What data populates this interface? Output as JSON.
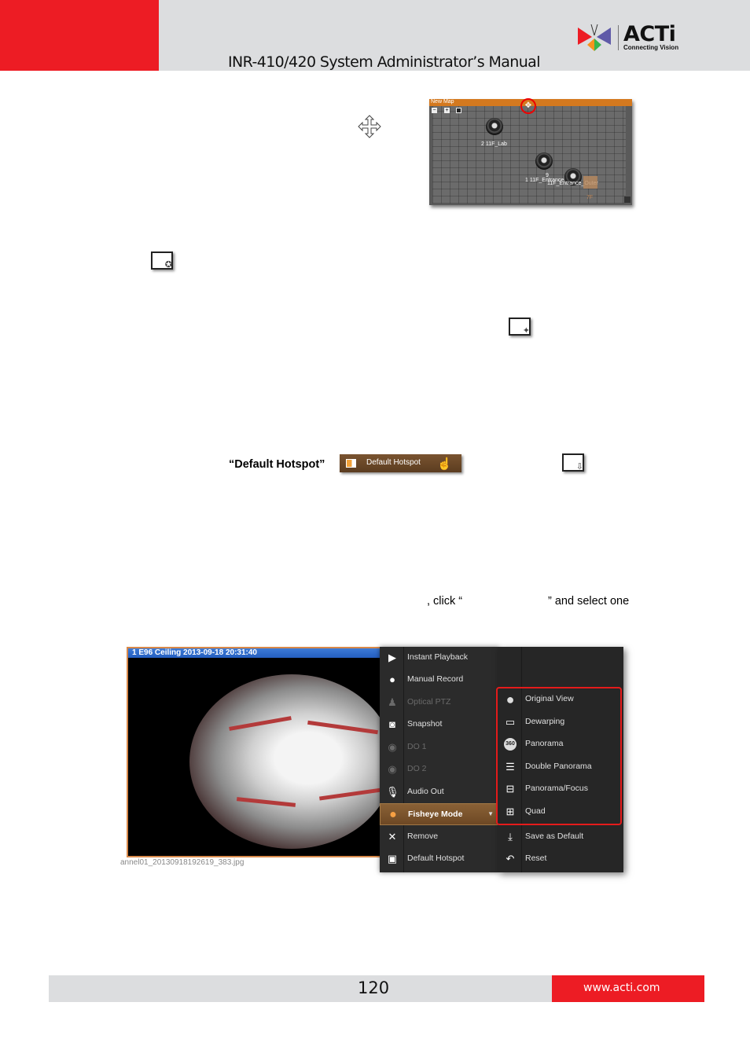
{
  "header": {
    "title": "INR-410/420 System Administrator’s Manual",
    "logo": {
      "brand": "ACTi",
      "tagline": "Connecting Vision"
    }
  },
  "map_screenshot": {
    "title": "New Map",
    "tools": [
      "zoom-out",
      "zoom-in",
      "fit"
    ],
    "move_icon": "move-cross-icon",
    "cameras": [
      {
        "label": "2 11F_Lab"
      },
      {
        "label": "9"
      },
      {
        "label": "1 11F_Entrance"
      },
      {
        "label": "11F_Entrance_Outer"
      }
    ],
    "floor_label": "7F"
  },
  "icons": {
    "move": "move-cross-icon",
    "hotspot": "default-hotspot-icon"
  },
  "default_hotspot_line": {
    "label": "“Default  Hotspot”",
    "button_label": "Default Hotspot"
  },
  "fisheye_line": {
    "part1": ", click “",
    "part2": "” and select one"
  },
  "fisheye_screenshot": {
    "title": "1 E96 Ceiling   2013-09-18 20:31:40",
    "filename": "annel01_20130918192619_383.jpg",
    "context_menu": [
      {
        "label": "Instant Playback",
        "icon": "play-icon",
        "enabled": true
      },
      {
        "label": "Manual Record",
        "icon": "record-icon",
        "enabled": true
      },
      {
        "label": "Optical PTZ",
        "icon": "ptz-icon",
        "enabled": false
      },
      {
        "label": "Snapshot",
        "icon": "camera-icon",
        "enabled": true
      },
      {
        "label": "DO 1",
        "icon": "do-icon",
        "enabled": false
      },
      {
        "label": "DO 2",
        "icon": "do-icon",
        "enabled": false
      },
      {
        "label": "Audio Out",
        "icon": "microphone-icon",
        "enabled": true
      },
      {
        "label": "Fisheye Mode",
        "icon": "fisheye-icon",
        "enabled": true,
        "active": true
      },
      {
        "label": "Remove",
        "icon": "close-icon",
        "enabled": true
      },
      {
        "label": "Default Hotspot",
        "icon": "hotspot-icon",
        "enabled": true
      }
    ],
    "submenu": [
      {
        "label": "Original View",
        "icon": "circle-icon"
      },
      {
        "label": "Dewarping",
        "icon": "rectangle-icon"
      },
      {
        "label": "Panorama",
        "icon": "360-icon"
      },
      {
        "label": "Double Panorama",
        "icon": "double-bar-icon"
      },
      {
        "label": "Panorama/Focus",
        "icon": "panorama-focus-icon"
      },
      {
        "label": "Quad",
        "icon": "quad-icon"
      },
      {
        "label": "Save as Default",
        "icon": "download-icon"
      },
      {
        "label": "Reset",
        "icon": "undo-icon"
      }
    ]
  },
  "footer": {
    "page_number": "120",
    "url": "www.acti.com"
  }
}
